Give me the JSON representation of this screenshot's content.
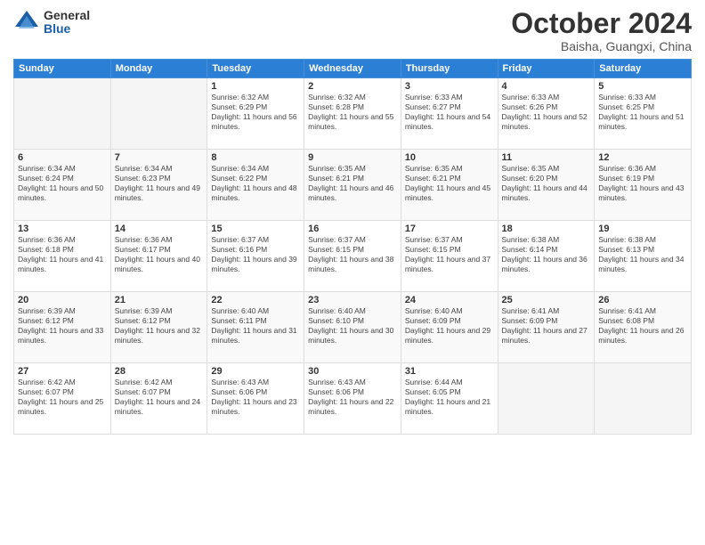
{
  "header": {
    "logo_general": "General",
    "logo_blue": "Blue",
    "month": "October 2024",
    "location": "Baisha, Guangxi, China"
  },
  "weekdays": [
    "Sunday",
    "Monday",
    "Tuesday",
    "Wednesday",
    "Thursday",
    "Friday",
    "Saturday"
  ],
  "weeks": [
    [
      {
        "day": "",
        "info": ""
      },
      {
        "day": "",
        "info": ""
      },
      {
        "day": "1",
        "info": "Sunrise: 6:32 AM\nSunset: 6:29 PM\nDaylight: 11 hours and 56 minutes."
      },
      {
        "day": "2",
        "info": "Sunrise: 6:32 AM\nSunset: 6:28 PM\nDaylight: 11 hours and 55 minutes."
      },
      {
        "day": "3",
        "info": "Sunrise: 6:33 AM\nSunset: 6:27 PM\nDaylight: 11 hours and 54 minutes."
      },
      {
        "day": "4",
        "info": "Sunrise: 6:33 AM\nSunset: 6:26 PM\nDaylight: 11 hours and 52 minutes."
      },
      {
        "day": "5",
        "info": "Sunrise: 6:33 AM\nSunset: 6:25 PM\nDaylight: 11 hours and 51 minutes."
      }
    ],
    [
      {
        "day": "6",
        "info": "Sunrise: 6:34 AM\nSunset: 6:24 PM\nDaylight: 11 hours and 50 minutes."
      },
      {
        "day": "7",
        "info": "Sunrise: 6:34 AM\nSunset: 6:23 PM\nDaylight: 11 hours and 49 minutes."
      },
      {
        "day": "8",
        "info": "Sunrise: 6:34 AM\nSunset: 6:22 PM\nDaylight: 11 hours and 48 minutes."
      },
      {
        "day": "9",
        "info": "Sunrise: 6:35 AM\nSunset: 6:21 PM\nDaylight: 11 hours and 46 minutes."
      },
      {
        "day": "10",
        "info": "Sunrise: 6:35 AM\nSunset: 6:21 PM\nDaylight: 11 hours and 45 minutes."
      },
      {
        "day": "11",
        "info": "Sunrise: 6:35 AM\nSunset: 6:20 PM\nDaylight: 11 hours and 44 minutes."
      },
      {
        "day": "12",
        "info": "Sunrise: 6:36 AM\nSunset: 6:19 PM\nDaylight: 11 hours and 43 minutes."
      }
    ],
    [
      {
        "day": "13",
        "info": "Sunrise: 6:36 AM\nSunset: 6:18 PM\nDaylight: 11 hours and 41 minutes."
      },
      {
        "day": "14",
        "info": "Sunrise: 6:36 AM\nSunset: 6:17 PM\nDaylight: 11 hours and 40 minutes."
      },
      {
        "day": "15",
        "info": "Sunrise: 6:37 AM\nSunset: 6:16 PM\nDaylight: 11 hours and 39 minutes."
      },
      {
        "day": "16",
        "info": "Sunrise: 6:37 AM\nSunset: 6:15 PM\nDaylight: 11 hours and 38 minutes."
      },
      {
        "day": "17",
        "info": "Sunrise: 6:37 AM\nSunset: 6:15 PM\nDaylight: 11 hours and 37 minutes."
      },
      {
        "day": "18",
        "info": "Sunrise: 6:38 AM\nSunset: 6:14 PM\nDaylight: 11 hours and 36 minutes."
      },
      {
        "day": "19",
        "info": "Sunrise: 6:38 AM\nSunset: 6:13 PM\nDaylight: 11 hours and 34 minutes."
      }
    ],
    [
      {
        "day": "20",
        "info": "Sunrise: 6:39 AM\nSunset: 6:12 PM\nDaylight: 11 hours and 33 minutes."
      },
      {
        "day": "21",
        "info": "Sunrise: 6:39 AM\nSunset: 6:12 PM\nDaylight: 11 hours and 32 minutes."
      },
      {
        "day": "22",
        "info": "Sunrise: 6:40 AM\nSunset: 6:11 PM\nDaylight: 11 hours and 31 minutes."
      },
      {
        "day": "23",
        "info": "Sunrise: 6:40 AM\nSunset: 6:10 PM\nDaylight: 11 hours and 30 minutes."
      },
      {
        "day": "24",
        "info": "Sunrise: 6:40 AM\nSunset: 6:09 PM\nDaylight: 11 hours and 29 minutes."
      },
      {
        "day": "25",
        "info": "Sunrise: 6:41 AM\nSunset: 6:09 PM\nDaylight: 11 hours and 27 minutes."
      },
      {
        "day": "26",
        "info": "Sunrise: 6:41 AM\nSunset: 6:08 PM\nDaylight: 11 hours and 26 minutes."
      }
    ],
    [
      {
        "day": "27",
        "info": "Sunrise: 6:42 AM\nSunset: 6:07 PM\nDaylight: 11 hours and 25 minutes."
      },
      {
        "day": "28",
        "info": "Sunrise: 6:42 AM\nSunset: 6:07 PM\nDaylight: 11 hours and 24 minutes."
      },
      {
        "day": "29",
        "info": "Sunrise: 6:43 AM\nSunset: 6:06 PM\nDaylight: 11 hours and 23 minutes."
      },
      {
        "day": "30",
        "info": "Sunrise: 6:43 AM\nSunset: 6:06 PM\nDaylight: 11 hours and 22 minutes."
      },
      {
        "day": "31",
        "info": "Sunrise: 6:44 AM\nSunset: 6:05 PM\nDaylight: 11 hours and 21 minutes."
      },
      {
        "day": "",
        "info": ""
      },
      {
        "day": "",
        "info": ""
      }
    ]
  ]
}
